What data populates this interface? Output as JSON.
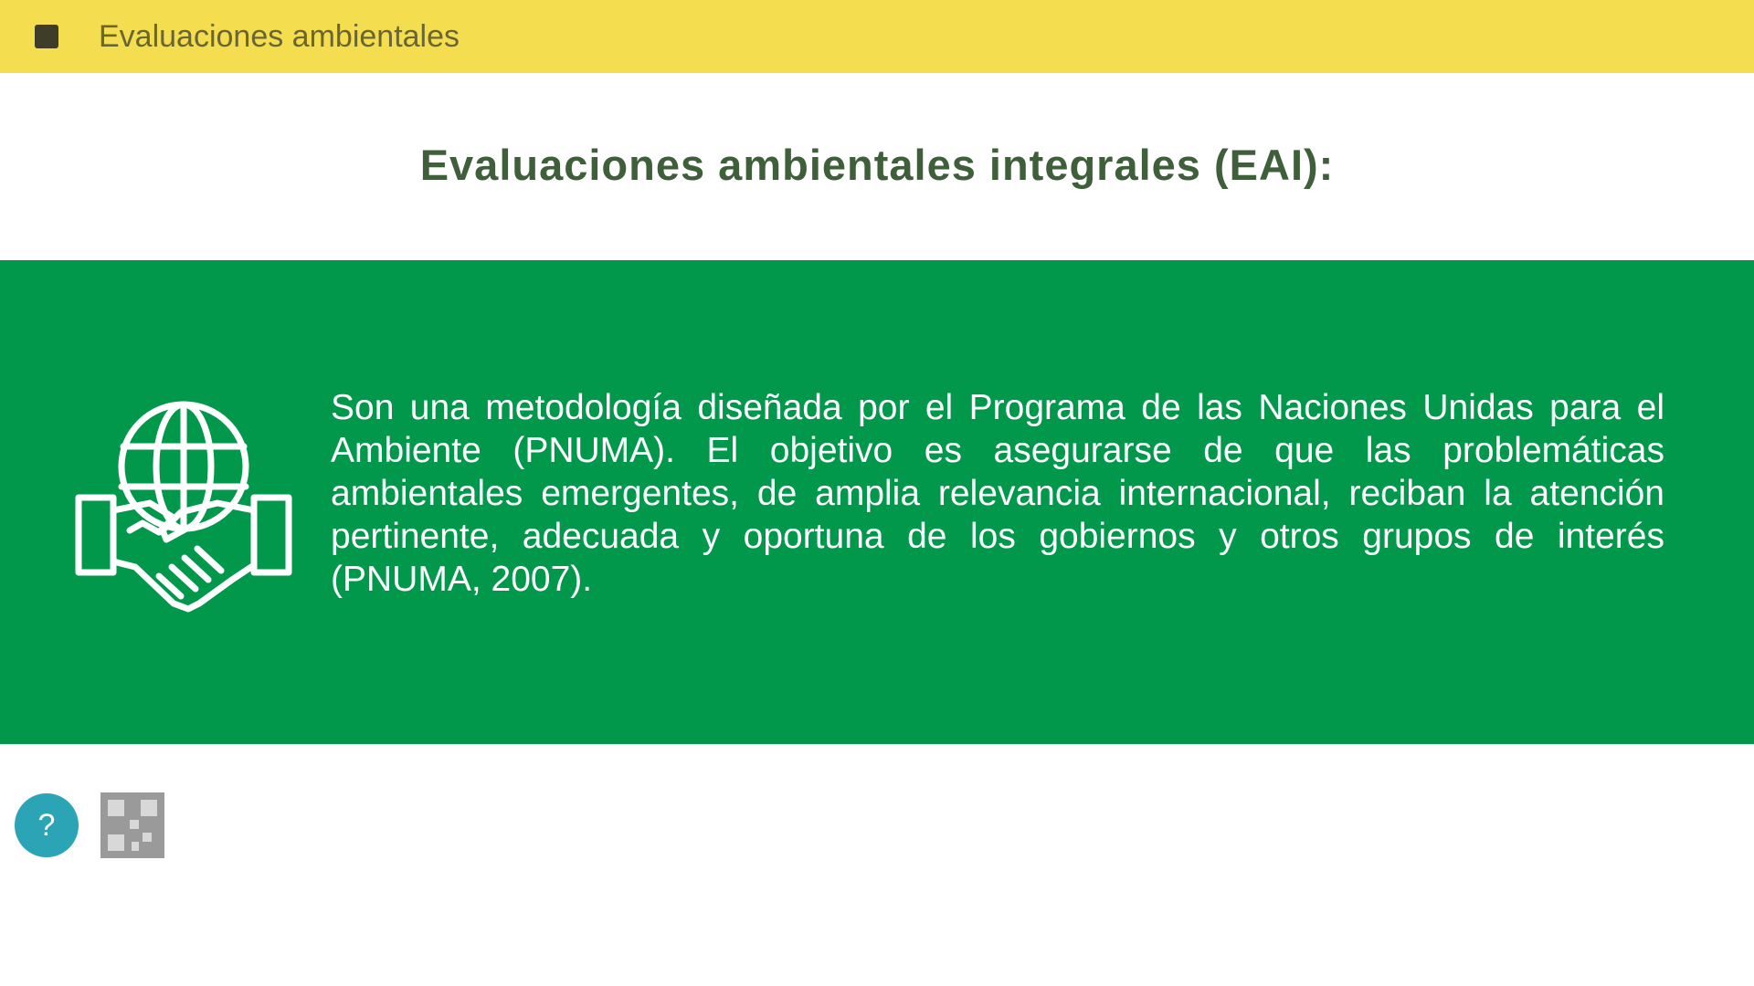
{
  "header": {
    "menu_icon": "menu-square-icon",
    "title": "Evaluaciones ambientales",
    "background": "#f4dd4e"
  },
  "main": {
    "title": "Evaluaciones ambientales integrales (EAI):"
  },
  "banner": {
    "icon": "globe-handshake-icon",
    "background": "#02984c",
    "text": "Son una metodología diseñada por el Programa de las Naciones Unidas para el Ambiente (PNUMA). El objetivo es asegurarse de que las problemáticas ambientales emergentes, de amplia relevancia internacional, reciban la atención pertinente, adecuada y oportuna de los gobiernos y otros grupos de interés (PNUMA, 2007)."
  },
  "tools": {
    "help_label": "?",
    "help_color": "#2ba4b6",
    "qr_icon": "qr-code-icon"
  }
}
